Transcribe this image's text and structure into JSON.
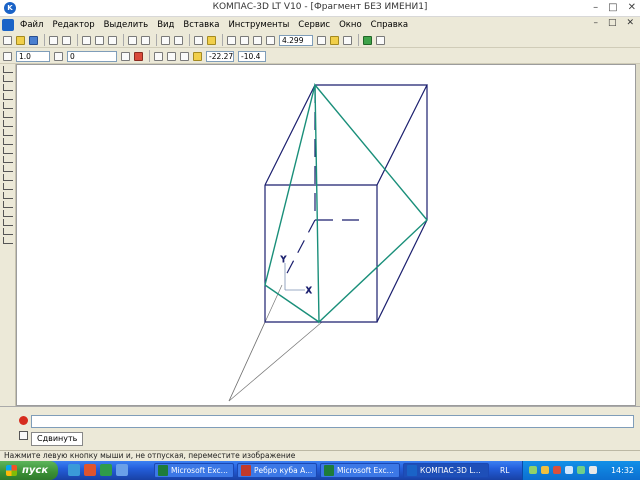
{
  "window": {
    "title": "КОМПАС-3D LT V10 - [Фрагмент БЕЗ ИМЕНИ1]",
    "app_icon_glyph": "K"
  },
  "menu": {
    "items": [
      "Файл",
      "Редактор",
      "Выделить",
      "Вид",
      "Вставка",
      "Инструменты",
      "Сервис",
      "Окно",
      "Справка"
    ]
  },
  "toolbar": {
    "zoom_value": "4.299",
    "line_width": "1.0",
    "layer": "0",
    "coord_x": "-22.27",
    "coord_y": "-10.4"
  },
  "drawing": {
    "axis_x_label": "X",
    "axis_y_label": "Y",
    "edge_color": "#1b1f6e",
    "section_color": "#1a8f7a",
    "construction_color": "#777777"
  },
  "command_panel": {
    "command_name": "Сдвинуть"
  },
  "status_bar": {
    "hint": "Нажмите левую кнопку мыши и, не отпуская, переместите изображение"
  },
  "taskbar": {
    "start_label": "пуск",
    "tasks": [
      {
        "label": "Microsoft Exc...",
        "icon_color": "#1e7c3a"
      },
      {
        "label": "Ребро куба А...",
        "icon_color": "#c23a2a"
      },
      {
        "label": "Microsoft Exc...",
        "icon_color": "#1e7c3a"
      },
      {
        "label": "КОМПАС-3D L...",
        "icon_color": "#1a63c7"
      }
    ],
    "language": "RL",
    "clock": "14:32"
  }
}
